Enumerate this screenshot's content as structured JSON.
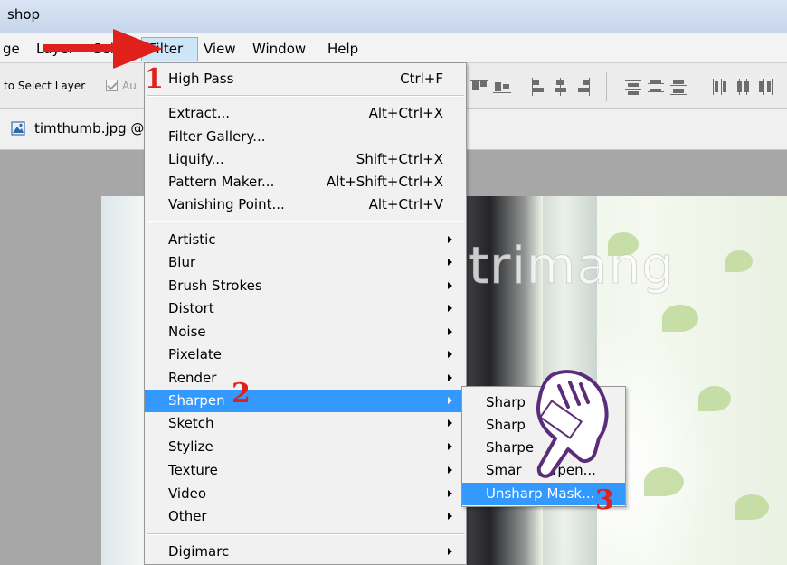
{
  "titlebar": {
    "text": "shop"
  },
  "menubar": {
    "items": [
      "ge",
      "Layer",
      "Sel",
      "Filter",
      "View",
      "Window",
      "Help"
    ]
  },
  "options": {
    "select_label": "to Select Layer",
    "auto_label": "Au"
  },
  "document": {
    "title": "timthumb.jpg @"
  },
  "filter_menu": {
    "items": [
      {
        "label": "High Pass",
        "shortcut": "Ctrl+F"
      },
      {
        "label": "Extract...",
        "shortcut": "Alt+Ctrl+X"
      },
      {
        "label": "Filter Gallery...",
        "shortcut": ""
      },
      {
        "label": "Liquify...",
        "shortcut": "Shift+Ctrl+X"
      },
      {
        "label": "Pattern Maker...",
        "shortcut": "Alt+Shift+Ctrl+X"
      },
      {
        "label": "Vanishing Point...",
        "shortcut": "Alt+Ctrl+V"
      },
      {
        "label": "Artistic"
      },
      {
        "label": "Blur"
      },
      {
        "label": "Brush Strokes"
      },
      {
        "label": "Distort"
      },
      {
        "label": "Noise"
      },
      {
        "label": "Pixelate"
      },
      {
        "label": "Render"
      },
      {
        "label": "Sharpen"
      },
      {
        "label": "Sketch"
      },
      {
        "label": "Stylize"
      },
      {
        "label": "Texture"
      },
      {
        "label": "Video"
      },
      {
        "label": "Other"
      },
      {
        "label": "Digimarc"
      }
    ]
  },
  "sharpen_submenu": {
    "items": [
      "Sharp",
      "Sharp",
      "Sharpe",
      "Smar",
      "Unsharp Mask..."
    ],
    "fragments": [
      "re",
      "arpen..."
    ]
  },
  "annotations": {
    "step1": "1",
    "step2": "2",
    "step3": "3"
  },
  "watermark": {
    "text": "uantrimang"
  },
  "colors": {
    "highlight": "#3399ff",
    "annotation_red": "#e0201b",
    "menu_bg": "#f1f1f1"
  }
}
